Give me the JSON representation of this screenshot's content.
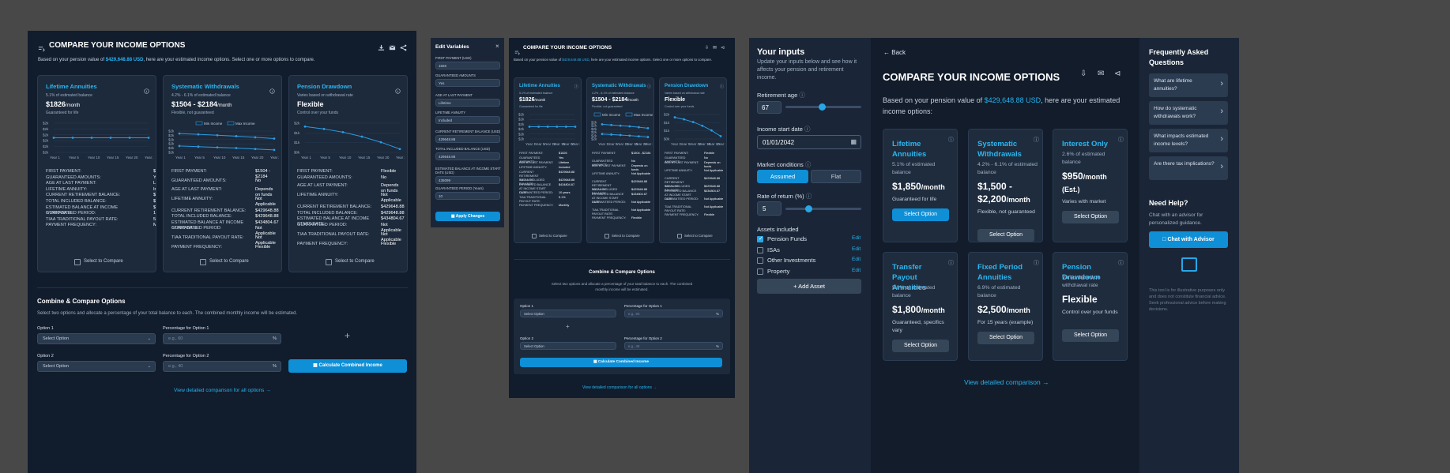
{
  "panel1": {
    "title": "COMPARE YOUR INCOME OPTIONS",
    "subtitle_pre": "Based on your pension value of ",
    "subtitle_amount": "$429,648.88 USD",
    "subtitle_post": ", here are your estimated income options. Select one or more options to compare.",
    "cards": [
      {
        "title": "Lifetime Annuities",
        "sub": "5.1% of estimated balance",
        "amount": "$1826",
        "unit": "/month",
        "note": "Guaranteed for life",
        "rows": [
          [
            "FIRST PAYMENT:",
            "$1826"
          ],
          [
            "GUARANTEED AMOUNTS:",
            "Yes"
          ],
          [
            "AGE AT LAST PAYMENT:",
            "Lifetime"
          ],
          [
            "LIFETIME ANNUITY:",
            "Included"
          ],
          [
            "CURRENT RETIREMENT BALANCE:",
            "$429648.88"
          ],
          [
            "TOTAL INCLUDED BALANCE:",
            "$429648.88"
          ],
          [
            "ESTIMATED BALANCE AT INCOME START DATE:",
            "$434804.67"
          ],
          [
            "GUARANTEED PERIOD:",
            "10 years"
          ],
          [
            "TIAA TRADITIONAL PAYOUT RATE:",
            "5.1%"
          ],
          [
            "PAYMENT FREQUENCY:",
            "Monthly"
          ]
        ],
        "compare": "Select to Compare"
      },
      {
        "title": "Systematic Withdrawals",
        "sub": "4.2% - 6.1% of estimated balance",
        "amount": "$1504 - $2184",
        "unit": "/month",
        "note": "Flexible, not guaranteed",
        "rows": [
          [
            "FIRST PAYMENT:",
            "$1504 - $2184"
          ],
          [
            "GUARANTEED AMOUNTS:",
            "No"
          ],
          [
            "AGE AT LAST PAYMENT:",
            "Depends on funds"
          ],
          [
            "LIFETIME ANNUITY:",
            "Not Applicable"
          ],
          [
            "CURRENT RETIREMENT BALANCE:",
            "$429648.88"
          ],
          [
            "TOTAL INCLUDED BALANCE:",
            "$429648.88"
          ],
          [
            "ESTIMATED BALANCE AT INCOME START DATE:",
            "$434804.67"
          ],
          [
            "GUARANTEED PERIOD:",
            "Not Applicable"
          ],
          [
            "TIAA TRADITIONAL PAYOUT RATE:",
            "Not Applicable"
          ],
          [
            "PAYMENT FREQUENCY:",
            "Flexible"
          ]
        ],
        "compare": "Select to Compare"
      },
      {
        "title": "Pension Drawdown",
        "sub": "Varies based on withdrawal rate",
        "amount": "Flexible",
        "unit": "",
        "note": "Control over your funds",
        "rows": [
          [
            "FIRST PAYMENT:",
            "Flexible"
          ],
          [
            "GUARANTEED AMOUNTS:",
            "No"
          ],
          [
            "AGE AT LAST PAYMENT:",
            "Depends on funds"
          ],
          [
            "LIFETIME ANNUITY:",
            "Not Applicable"
          ],
          [
            "CURRENT RETIREMENT BALANCE:",
            "$429648.88"
          ],
          [
            "TOTAL INCLUDED BALANCE:",
            "$429648.88"
          ],
          [
            "ESTIMATED BALANCE AT INCOME START DATE:",
            "$434804.67"
          ],
          [
            "GUARANTEED PERIOD:",
            "Not Applicable"
          ],
          [
            "TIAA TRADITIONAL PAYOUT RATE:",
            "Not Applicable"
          ],
          [
            "PAYMENT FREQUENCY:",
            "Flexible"
          ]
        ],
        "compare": "Select to Compare"
      }
    ],
    "chart_ticks_y": [
      "$2k",
      "$2k",
      "$2k",
      "$2k",
      "$2k",
      "$2k"
    ],
    "chart_ticks_y3": [
      "$2k",
      "$1k",
      "$1k",
      "$0k"
    ],
    "chart_ticks_x": [
      "Year 1",
      "Year 5",
      "Year 10",
      "Year 15",
      "Year 20",
      "Year 25"
    ],
    "legend_min": "Min Income",
    "legend_max": "Max Income",
    "combine_title": "Combine & Compare Options",
    "combine_desc": "Select two options and allocate a percentage of your total balance to each. The combined monthly income will be estimated.",
    "opt1_label": "Option 1",
    "pct1_label": "Percentage for Option 1",
    "opt2_label": "Option 2",
    "pct2_label": "Percentage for Option 2",
    "select_placeholder": "Select Option",
    "pct_placeholder": "e.g., 60",
    "pct_placeholder2": "e.g., 40",
    "pct_sign": "%",
    "plus": "+",
    "calc_btn": "Calculate Combined Income",
    "view_link": "View detailed comparison for all options"
  },
  "chart_data": [
    {
      "type": "line",
      "title": "Lifetime Annuities",
      "x": [
        "Year 1",
        "Year 5",
        "Year 10",
        "Year 15",
        "Year 20",
        "Year 25"
      ],
      "series": [
        {
          "values": [
            1826,
            1826,
            1826,
            1826,
            1826,
            1826
          ]
        }
      ]
    },
    {
      "type": "line",
      "title": "Systematic Withdrawals",
      "x": [
        "Year 1",
        "Year 5",
        "Year 10",
        "Year 15",
        "Year 20",
        "Year 25"
      ],
      "series": [
        {
          "name": "Min Income",
          "values": [
            1504,
            1470,
            1430,
            1390,
            1340,
            1290
          ]
        },
        {
          "name": "Max Income",
          "values": [
            2184,
            2140,
            2090,
            2040,
            1980,
            1910
          ]
        }
      ]
    },
    {
      "type": "line",
      "title": "Pension Drawdown",
      "x": [
        "Year 1",
        "Year 5",
        "Year 10",
        "Year 15",
        "Year 20",
        "Year 25"
      ],
      "series": [
        {
          "values": [
            2000,
            1880,
            1720,
            1500,
            1220,
            880
          ]
        }
      ]
    }
  ],
  "panel2": {
    "edit_title": "Edit Variables",
    "close": "×",
    "fields": [
      {
        "label": "FIRST PAYMENT (USD)",
        "value": "1826"
      },
      {
        "label": "GUARANTEED AMOUNTS",
        "value": "Yes"
      },
      {
        "label": "AGE AT LAST PAYMENT",
        "value": "Lifetime"
      },
      {
        "label": "LIFETIME ANNUITY",
        "value": "Included"
      },
      {
        "label": "CURRENT RETIREMENT BALANCE (USD)",
        "value": "429648.88"
      },
      {
        "label": "TOTAL INCLUDED BALANCE (USD)",
        "value": "429648.88"
      },
      {
        "label": "ESTIMATED BALANCE AT INCOME START DATE (USD)",
        "value": "435099"
      },
      {
        "label": "GUARANTEED PERIOD (Years)",
        "value": "10"
      }
    ],
    "apply_btn": "Apply Changes"
  },
  "panel3": {
    "inputs_title": "Your inputs",
    "inputs_desc": "Update your inputs below and see how it affects your pension and retirement income.",
    "ret_age_label": "Retirement age",
    "ret_age_value": "67",
    "ret_age_slider": 0.48,
    "start_date_label": "Income start date",
    "start_date_value": "01/01/2042",
    "market_label": "Market conditions",
    "market_assumed": "Assumed",
    "market_flat": "Flat",
    "rate_label": "Rate of return (%)",
    "rate_value": "5",
    "rate_slider": 0.3,
    "assets_label": "Assets included",
    "assets": [
      {
        "name": "Pension Funds",
        "checked": true,
        "edit": "Edit"
      },
      {
        "name": "ISAs",
        "checked": false,
        "edit": "Edit"
      },
      {
        "name": "Other Investments",
        "checked": false,
        "edit": "Edit"
      },
      {
        "name": "Property",
        "checked": false,
        "edit": "Edit"
      }
    ],
    "add_asset": "Add Asset",
    "back": "Back",
    "title": "COMPARE YOUR INCOME OPTIONS",
    "subtitle_pre": "Based on your pension value of ",
    "subtitle_amount": "$429,648.88 USD",
    "subtitle_post": ", here are your estimated income options:",
    "cards": [
      {
        "title": "Lifetime Annuities",
        "sub": "5.1% of estimated balance",
        "amount": "$1,850",
        "unit": "/month",
        "note": "Guaranteed for life",
        "btn": "Select Option"
      },
      {
        "title": "Systematic Withdrawals",
        "sub": "4.2% - 6.1% of estimated balance",
        "amount": "$1,500 - $2,200",
        "unit": "/month",
        "note": "Flexible, not guaranteed",
        "btn": "Select Option"
      },
      {
        "title": "Interest Only",
        "sub": "2.6% of estimated balance",
        "amount": "$950",
        "unit": "/month",
        "extra": "(Est.)",
        "note": "Varies with market",
        "btn": "Select Option"
      },
      {
        "title": "Transfer Payout Annuities",
        "sub": "5.0% of estimated balance",
        "amount": "$1,800",
        "unit": "/month",
        "note": "Guaranteed, specifics vary",
        "btn": "Select Option"
      },
      {
        "title": "Fixed Period Annuities",
        "sub": "6.9% of estimated balance",
        "amount": "$2,500",
        "unit": "/month",
        "note": "For 15 years (example)",
        "btn": "Select Option"
      },
      {
        "title": "Pension Drawdown",
        "sub": "Varies based on withdrawal rate",
        "amount": "Flexible",
        "unit": "",
        "note": "Control over your funds",
        "btn": "Select Option"
      }
    ],
    "view_link": "View detailed comparison",
    "faq_title": "Frequently Asked Questions",
    "faqs": [
      "What are lifetime annuities?",
      "How do systematic withdrawals work?",
      "What impacts estimated income levels?",
      "Are there tax implications?"
    ],
    "help_title": "Need Help?",
    "help_desc": "Chat with an advisor for personalized guidance.",
    "chat_btn": "Chat with Advisor",
    "disclaimer": "This tool is for illustrative purposes only and does not constitute financial advice. Seek professional advice before making decisions."
  }
}
